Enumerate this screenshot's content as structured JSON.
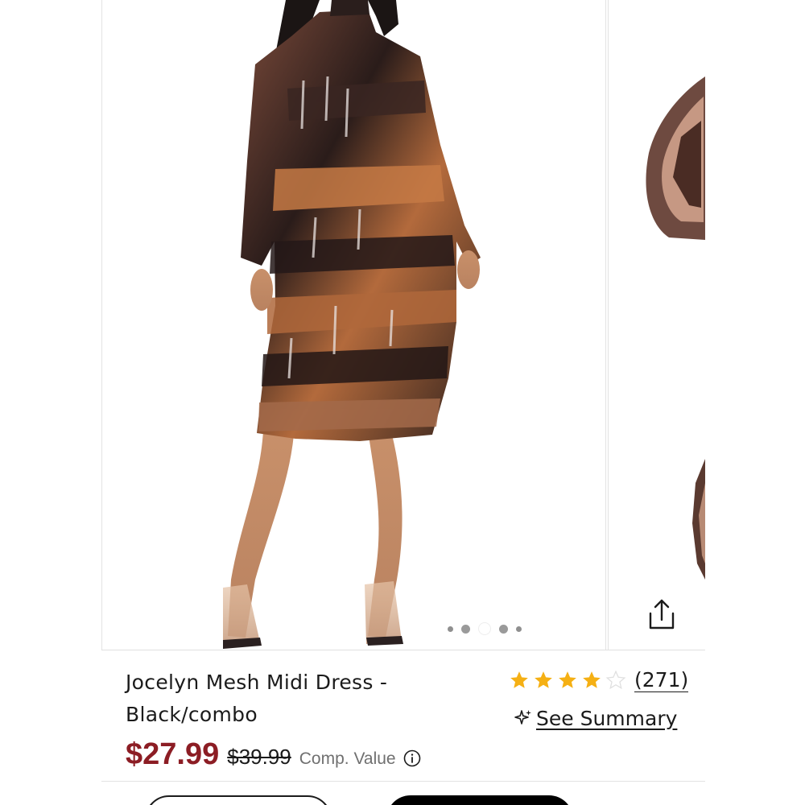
{
  "product": {
    "title": "Jocelyn Mesh Midi Dress - Black/combo",
    "price": "$27.99",
    "original_price": "$39.99",
    "comp_value_label": "Comp. Value",
    "price_color": "#8c1d24"
  },
  "rating": {
    "stars": 4,
    "max_stars": 5,
    "count_label": "(271)",
    "star_color": "#f5b014"
  },
  "summary": {
    "label": "See Summary",
    "icon": "sparkle-icon"
  },
  "gallery": {
    "image_count": 5,
    "active_index": 2,
    "share_icon": "share-icon"
  },
  "actions": {
    "outline_label": "",
    "solid_label": ""
  }
}
